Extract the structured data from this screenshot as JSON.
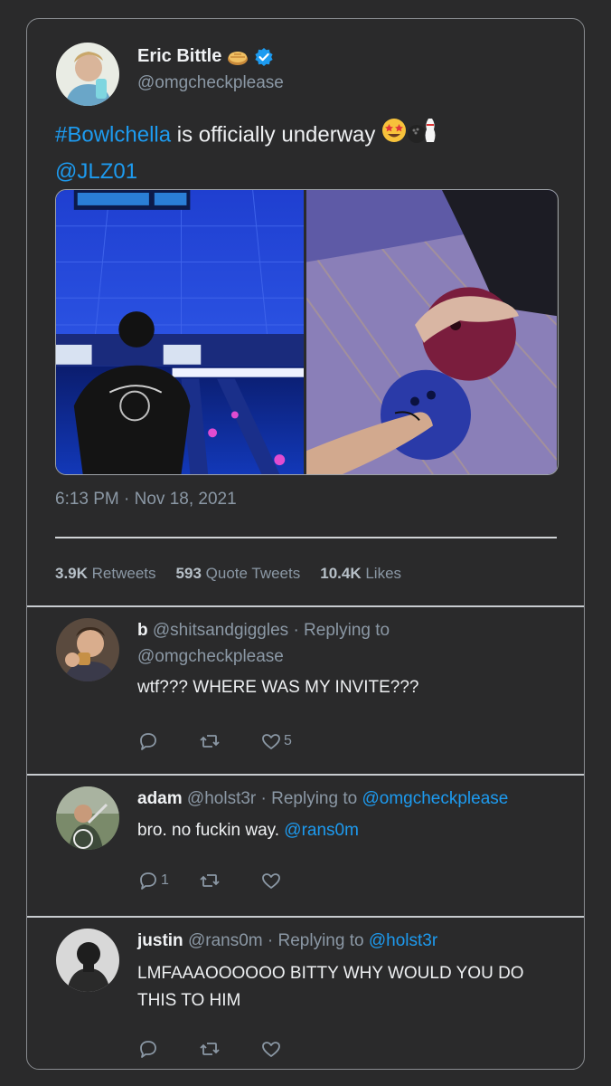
{
  "tweet": {
    "author_name": "Eric Bittle",
    "author_handle": "@omgcheckplease",
    "text_hashtag": "#Bowlchella",
    "text_body": " is officially underway ",
    "text_mention": "@JLZ01",
    "timestamp": "6:13 PM · Nov 18, 2021",
    "stats": {
      "retweets_count": "3.9K",
      "retweets_label": "Retweets",
      "quotes_count": "593",
      "quotes_label": "Quote Tweets",
      "likes_count": "10.4K",
      "likes_label": "Likes"
    }
  },
  "replies": [
    {
      "name": "b",
      "handle": "@shitsandgiggles",
      "replying_prefix": "· Replying to",
      "replying_to": "@omgcheckplease",
      "text": "wtf??? WHERE WAS MY INVITE???",
      "reply_count": "",
      "like_count": "5"
    },
    {
      "name": "adam",
      "handle": "@holst3r",
      "replying_prefix": "· Replying to",
      "replying_to": "@omgcheckplease",
      "text_main": "bro. no fuckin way. ",
      "text_mention": "@rans0m",
      "reply_count": "1",
      "like_count": ""
    },
    {
      "name": "justin",
      "handle": "@rans0m",
      "replying_prefix": "· Replying to",
      "replying_to": "@holst3r",
      "text_line1": "LMFAAAOOOOOO BITTY WHY WOULD YOU DO",
      "text_line2": "THIS TO HIM",
      "reply_count": "",
      "like_count": ""
    }
  ],
  "colors": {
    "background": "#2a2a2b",
    "link": "#1d9bf0",
    "muted": "#8b98a5",
    "verified": "#1d9bf0"
  },
  "icons": [
    "verified-badge-icon",
    "pie-emoji-icon",
    "star-struck-emoji-icon",
    "bowling-emoji-icon",
    "reply-icon",
    "retweet-icon",
    "like-icon"
  ]
}
